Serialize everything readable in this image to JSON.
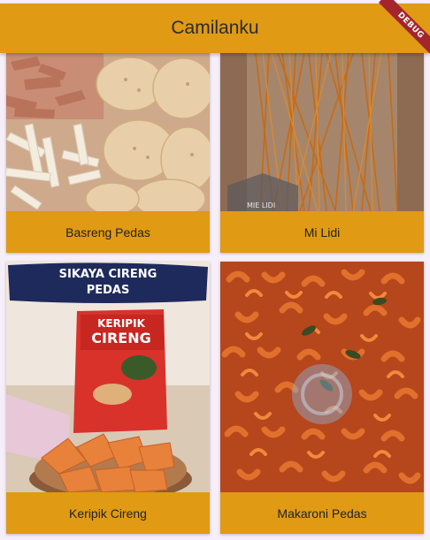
{
  "app_bar": {
    "title": "Camilanku",
    "debug_banner": "DEBUG"
  },
  "items": [
    {
      "label": "Basreng Pedas"
    },
    {
      "label": "Mi Lidi",
      "image_text": "MIE LIDI"
    },
    {
      "label": "Keripik Cireng",
      "image_banner": [
        "SIKAYA CIRENG",
        "PEDAS"
      ],
      "image_pack_text": [
        "KERIPIK",
        "CIRENG"
      ]
    },
    {
      "label": "Makaroni Pedas"
    }
  ]
}
